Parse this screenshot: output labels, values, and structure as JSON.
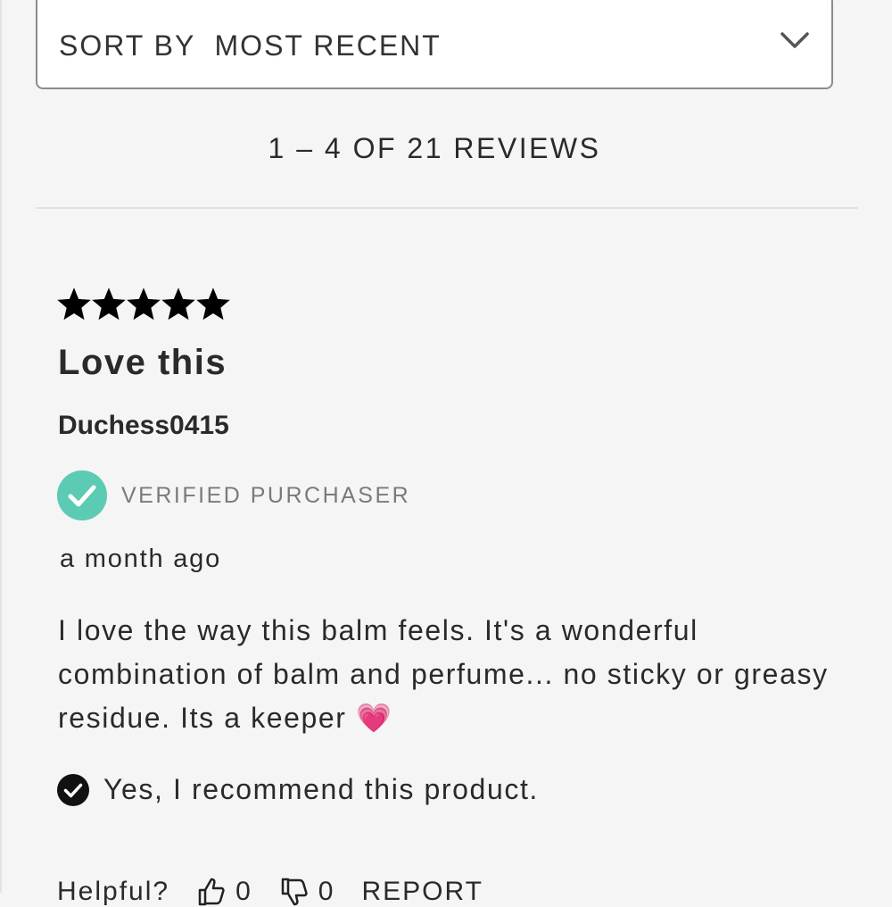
{
  "sort": {
    "label": "SORT BY  MOST RECENT",
    "chevron_icon": "chevron-down-icon"
  },
  "review_count": "1 – 4 OF 21 REVIEWS",
  "review": {
    "rating": 5,
    "rating_max": 5,
    "title": "Love this",
    "author": "Duchess0415",
    "verified_label": "VERIFIED PURCHASER",
    "date": "a month ago",
    "body": "I love the way this balm feels. It's a wonderful combination of balm and perfume... no sticky or greasy residue. Its a keeper 💗",
    "recommend_text": "Yes, I recommend this product.",
    "helpful_label": "Helpful?",
    "helpful_yes": "0",
    "helpful_no": "0",
    "report_label": "REPORT"
  },
  "colors": {
    "background": "#f4f5f4",
    "verified_badge": "#5ccbb3",
    "star": "#000000"
  }
}
